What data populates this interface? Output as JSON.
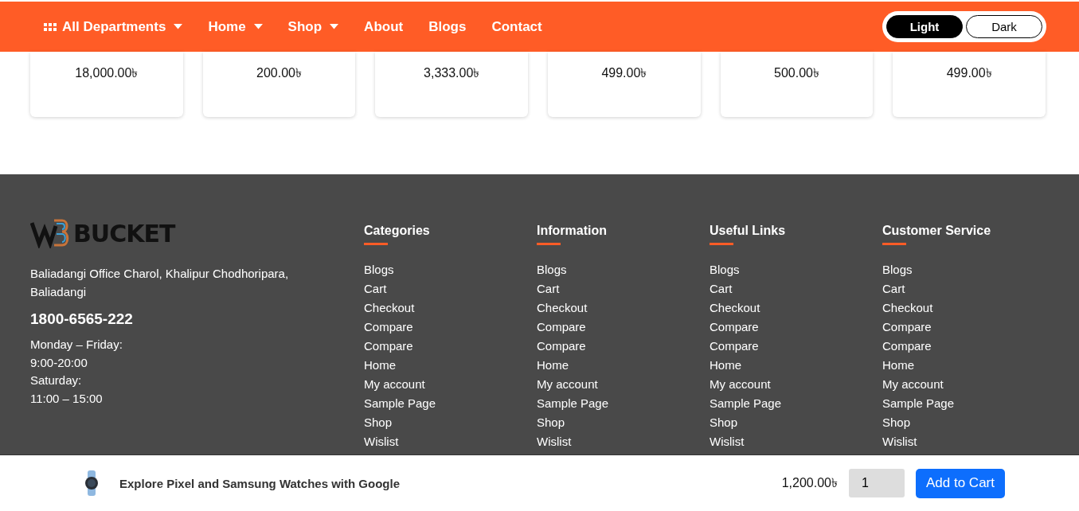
{
  "nav": {
    "items": [
      {
        "label": "All Departments",
        "kind": "departments"
      },
      {
        "label": "Home",
        "kind": "dropdown"
      },
      {
        "label": "Shop",
        "kind": "dropdown"
      },
      {
        "label": "About",
        "kind": "link"
      },
      {
        "label": "Blogs",
        "kind": "link"
      },
      {
        "label": "Contact",
        "kind": "link"
      }
    ],
    "theme_toggle": [
      {
        "label": "Light",
        "selected": true
      },
      {
        "label": "Dark",
        "selected": false
      }
    ]
  },
  "products": [
    {
      "price": "18,000.00৳"
    },
    {
      "price": "200.00৳"
    },
    {
      "price": "3,333.00৳"
    },
    {
      "price": "499.00৳"
    },
    {
      "price": "500.00৳"
    },
    {
      "price": "499.00৳"
    }
  ],
  "footer": {
    "logo_text": "BUCKET",
    "address": "Baliadangi Office Charol, Khalipur Chodhoripara, Baliadangi",
    "phone": "1800-6565-222",
    "hours": [
      "Monday – Friday:",
      "9:00-20:00",
      "Saturday:",
      "11:00 – 15:00"
    ],
    "columns": [
      {
        "title": "Categories",
        "links": [
          "Blogs",
          "Cart",
          "Checkout",
          "Compare",
          "Compare",
          "Home",
          "My account",
          "Sample Page",
          "Shop",
          "Wislist"
        ]
      },
      {
        "title": "Information",
        "links": [
          "Blogs",
          "Cart",
          "Checkout",
          "Compare",
          "Compare",
          "Home",
          "My account",
          "Sample Page",
          "Shop",
          "Wislist"
        ]
      },
      {
        "title": "Useful Links",
        "links": [
          "Blogs",
          "Cart",
          "Checkout",
          "Compare",
          "Compare",
          "Home",
          "My account",
          "Sample Page",
          "Shop",
          "Wislist"
        ]
      },
      {
        "title": "Customer Service",
        "links": [
          "Blogs",
          "Cart",
          "Checkout",
          "Compare",
          "Compare",
          "Home",
          "My account",
          "Sample Page",
          "Shop",
          "Wislist"
        ]
      }
    ]
  },
  "sticky_bar": {
    "product_name": "Explore Pixel and Samsung Watches with Google",
    "price": "1,200.00৳",
    "quantity": "1",
    "button": "Add to Cart"
  }
}
